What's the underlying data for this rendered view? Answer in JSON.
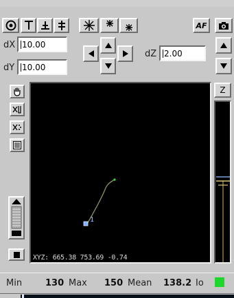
{
  "window": {
    "title_fragment": ""
  },
  "toolbar": {
    "af_label": "AF"
  },
  "delta": {
    "dx_label": "dX",
    "dx_value": "10.00",
    "dy_label": "dY",
    "dy_value": "10.00",
    "dz_label": "dZ",
    "dz_value": "2.00"
  },
  "z_panel": {
    "label": "Z"
  },
  "viewport": {
    "readout": "XYZ: 665.38 753.69 -0.74",
    "point_label": "1",
    "point_color": "#7fb0ff",
    "line_color": "#8f8f6a",
    "end_color": "#3fd13f"
  },
  "status": {
    "min_label": "Min",
    "min_value": "130",
    "max_label": "Max",
    "max_value": "150",
    "mean_label": "Mean",
    "mean_value": "138.2",
    "io_label": "Io",
    "indicator_color": "#21d62b"
  },
  "icons": {
    "toolbar": [
      "target-icon",
      "align-top-icon",
      "align-bottom-icon",
      "align-center-icon",
      "star-icon",
      "star-top-icon",
      "star-bottom-icon",
      "autofocus-button",
      "camera-icon"
    ],
    "side_tools": [
      "hand-icon",
      "clear-cursor-icon",
      "clear-points-icon",
      "list-icon",
      "slider-handle-icon",
      "stop-icon"
    ],
    "nav": [
      "arrow-up-icon",
      "arrow-down-icon",
      "arrow-left-icon",
      "arrow-right-icon"
    ]
  }
}
